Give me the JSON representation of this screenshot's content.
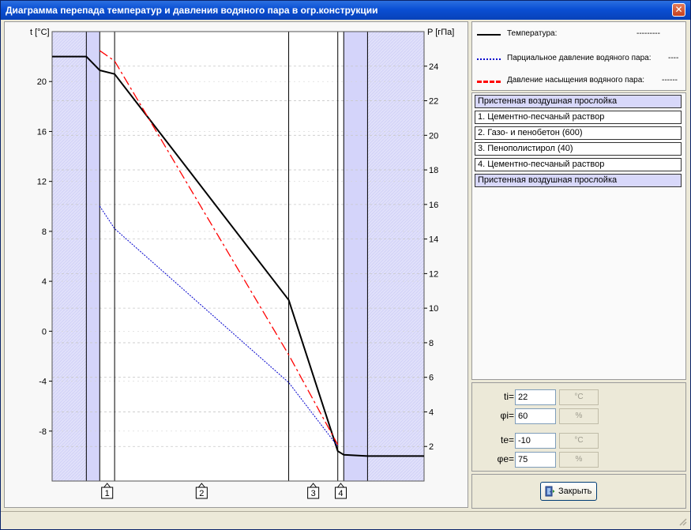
{
  "window": {
    "title": "Диаграмма перепада температур и давления водяного пара в огр.конструкции",
    "close_glyph": "✕"
  },
  "chart_data": {
    "type": "line",
    "y_left_label": "t [°C]",
    "y_right_label": "P [гПа]",
    "y_left_ticks": [
      "20",
      "16",
      "12",
      "8",
      "4",
      "0",
      "-4",
      "-8"
    ],
    "y_right_ticks": [
      "24",
      "22",
      "20",
      "18",
      "16",
      "14",
      "12",
      "10",
      "8",
      "6",
      "4",
      "2"
    ],
    "y_left_lim": [
      -12,
      24
    ],
    "y_right_lim": [
      0,
      26
    ],
    "layer_markers": [
      "1",
      "2",
      "3",
      "4"
    ],
    "series": [
      {
        "name": "Температура:",
        "axis": "left",
        "color": "#000000",
        "x": [
          0,
          0.46,
          0.64,
          0.84,
          3.18,
          3.84,
          3.92,
          4.24,
          5
        ],
        "values": [
          22.0,
          22.0,
          20.9,
          20.6,
          2.5,
          -9.6,
          -9.9,
          -10.0,
          -10.0
        ]
      },
      {
        "name": "Парциальное давление водяного пара:",
        "axis": "right",
        "color": "#0000cc",
        "x": [
          0.64,
          0.84,
          3.18,
          3.84
        ],
        "values": [
          15.9,
          14.6,
          5.7,
          2.0
        ]
      },
      {
        "name": "Давление насыщения водяного пара:",
        "axis": "right",
        "color": "#ff0000",
        "x": [
          0.64,
          0.84,
          3.18,
          3.84
        ],
        "values": [
          24.9,
          24.3,
          7.3,
          2.1
        ]
      }
    ]
  },
  "legend": {
    "items": [
      {
        "label": "Температура:",
        "dashes": "---------",
        "color": "#000000"
      },
      {
        "label": "Парциальное давление водяного пара:",
        "dashes": "----",
        "color": "#0000cc"
      },
      {
        "label": "Давление насыщения водяного пара:",
        "dashes": "------",
        "color": "#ff0000"
      }
    ]
  },
  "layers": [
    {
      "label": "Пристенная воздушная прослойка",
      "air": true
    },
    {
      "label": "1. Цементно-песчаный раствор",
      "air": false
    },
    {
      "label": "2. Газо- и пенобетон (600)",
      "air": false
    },
    {
      "label": "3. Пенополистирол (40)",
      "air": false
    },
    {
      "label": "4. Цементно-песчаный раствор",
      "air": false
    },
    {
      "label": "Пристенная воздушная прослойка",
      "air": true
    }
  ],
  "params": {
    "ti": {
      "label": "ti=",
      "value": "22",
      "unit": "°C"
    },
    "phi_i": {
      "label": "φi=",
      "value": "60",
      "unit": "%"
    },
    "te": {
      "label": "te=",
      "value": "-10",
      "unit": "°C"
    },
    "phi_e": {
      "label": "φe=",
      "value": "75",
      "unit": "%"
    }
  },
  "buttons": {
    "close_label": "Закрыть"
  }
}
